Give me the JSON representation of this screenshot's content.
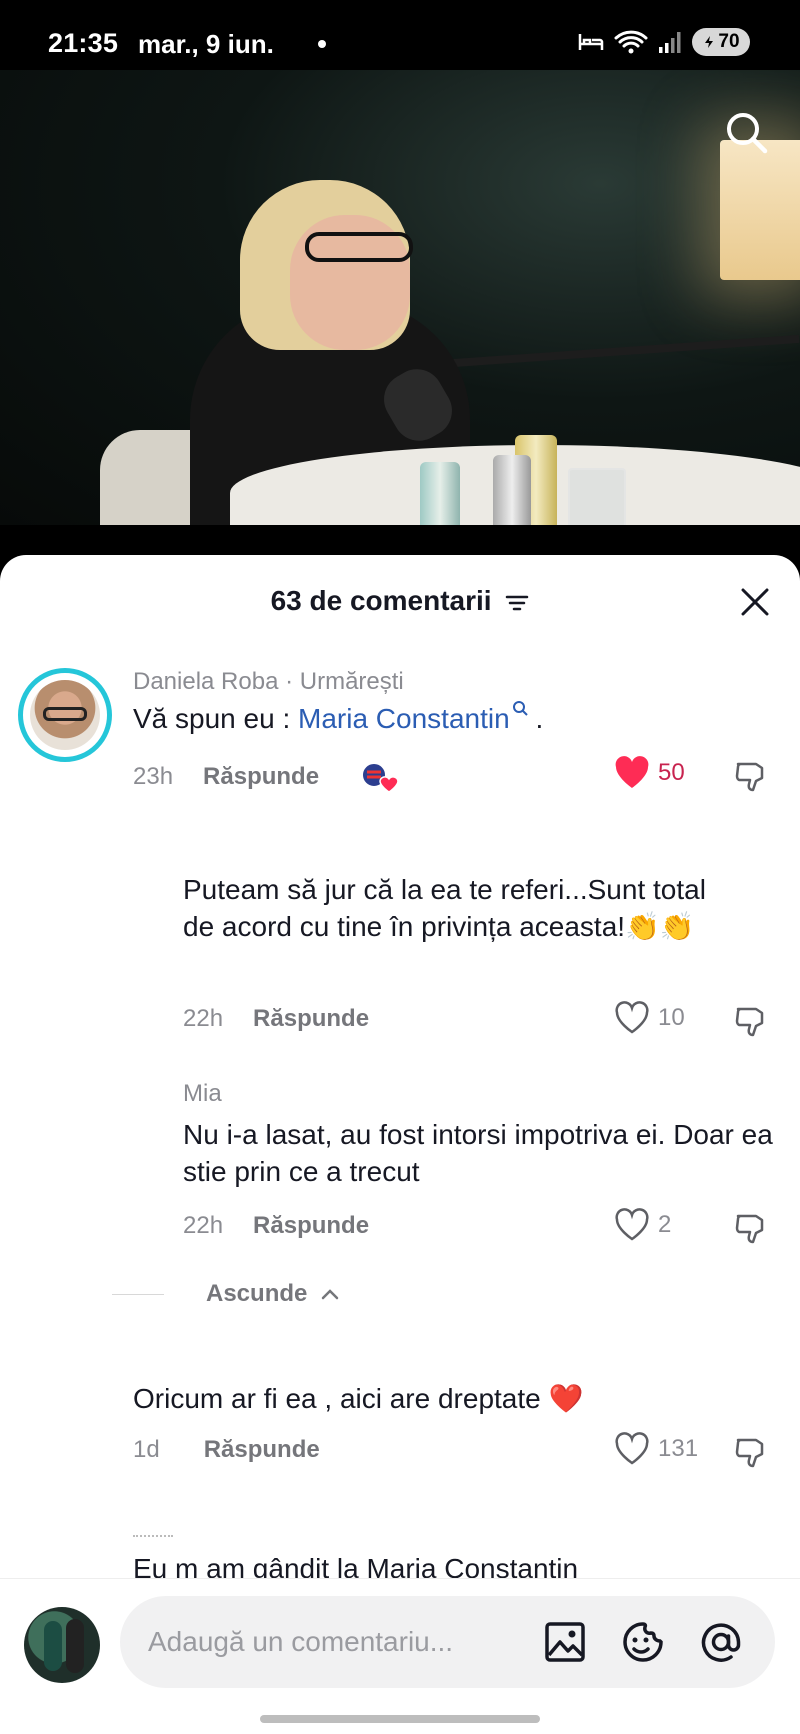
{
  "status_bar": {
    "time": "21:35",
    "date": "mar., 9 iun.",
    "battery": "70",
    "icons": [
      "alarm-bed-icon",
      "wifi-icon",
      "signal-icon",
      "battery-icon"
    ]
  },
  "video": {
    "search_icon": "search-icon"
  },
  "sheet": {
    "title": "63 de comentarii",
    "sort_icon": "sort-icon",
    "close_icon": "close-icon"
  },
  "comments": [
    {
      "author": "Daniela Roba · Urmărești",
      "text_prefix": "Vă spun eu : ",
      "mention": "Maria Constantin",
      "text_suffix": " .",
      "time": "23h",
      "reply_label": "Răspunde",
      "likes": "50",
      "liked": true,
      "creator_liked_badge": "creator-heart-badge"
    },
    {
      "author": "",
      "text": "Puteam să jur că la ea te referi...Sunt total de acord cu tine în privința aceasta!👏👏",
      "time": "22h",
      "reply_label": "Răspunde",
      "likes": "10"
    },
    {
      "author": "Mia",
      "text": "Nu i-a lasat, au fost intorsi impotriva ei. Doar ea stie prin ce a trecut",
      "time": "22h",
      "reply_label": "Răspunde",
      "likes": "2"
    },
    {
      "author": "",
      "text": "Oricum ar fi ea , aici are dreptate ❤️",
      "time": "1d",
      "reply_label": "Răspunde",
      "likes": "131"
    }
  ],
  "hide_replies_label": "Ascunde",
  "partial_comment": "Eu m am gândit la Maria Constantin",
  "composer": {
    "placeholder": "Adaugă un comentariu...",
    "icons": [
      "image-icon",
      "emoji-icon",
      "mention-icon"
    ]
  },
  "colors": {
    "like_active": "#fe2c55",
    "mention": "#2b5db3",
    "avatar_ring": "#25c6d9"
  }
}
